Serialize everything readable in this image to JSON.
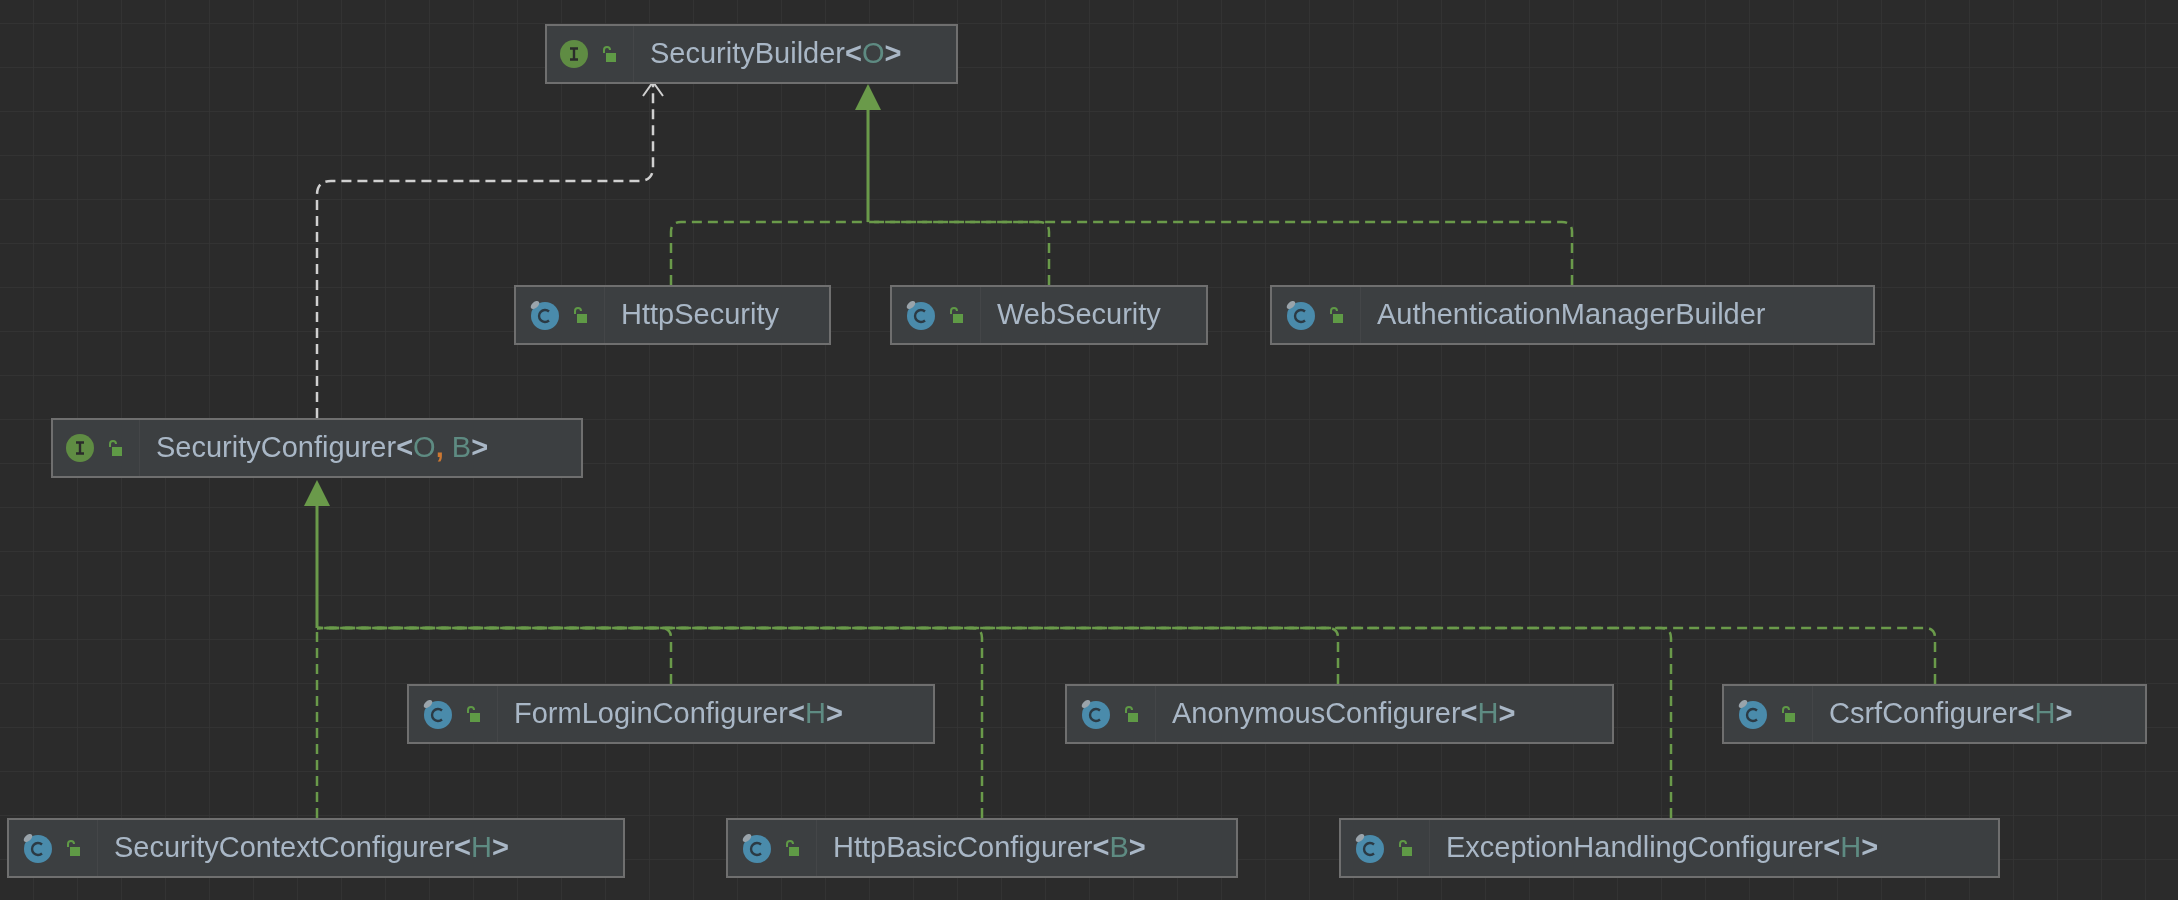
{
  "diagram": {
    "nodes": [
      {
        "kind": "interface",
        "label": [
          {
            "kind": "name",
            "text": "SecurityBuilder"
          },
          {
            "kind": "bracket",
            "text": "<"
          },
          {
            "kind": "param",
            "text": "O"
          },
          {
            "kind": "bracket",
            "text": ">"
          }
        ]
      },
      {
        "kind": "class",
        "label": [
          {
            "kind": "name",
            "text": "HttpSecurity"
          }
        ]
      },
      {
        "kind": "class",
        "label": [
          {
            "kind": "name",
            "text": "WebSecurity"
          }
        ]
      },
      {
        "kind": "class",
        "label": [
          {
            "kind": "name",
            "text": "AuthenticationManagerBuilder"
          }
        ]
      },
      {
        "kind": "interface",
        "label": [
          {
            "kind": "name",
            "text": "SecurityConfigurer"
          },
          {
            "kind": "bracket",
            "text": "<"
          },
          {
            "kind": "param",
            "text": "O"
          },
          {
            "kind": "separator",
            "text": ","
          },
          {
            "kind": "param",
            "text": " B"
          },
          {
            "kind": "bracket",
            "text": ">"
          }
        ]
      },
      {
        "kind": "class",
        "label": [
          {
            "kind": "name",
            "text": "FormLoginConfigurer"
          },
          {
            "kind": "bracket",
            "text": "<"
          },
          {
            "kind": "param",
            "text": "H"
          },
          {
            "kind": "bracket",
            "text": ">"
          }
        ]
      },
      {
        "kind": "class",
        "label": [
          {
            "kind": "name",
            "text": "AnonymousConfigurer"
          },
          {
            "kind": "bracket",
            "text": "<"
          },
          {
            "kind": "param",
            "text": "H"
          },
          {
            "kind": "bracket",
            "text": ">"
          }
        ]
      },
      {
        "kind": "class",
        "label": [
          {
            "kind": "name",
            "text": "CsrfConfigurer"
          },
          {
            "kind": "bracket",
            "text": "<"
          },
          {
            "kind": "param",
            "text": "H"
          },
          {
            "kind": "bracket",
            "text": ">"
          }
        ]
      },
      {
        "kind": "class",
        "label": [
          {
            "kind": "name",
            "text": "SecurityContextConfigurer"
          },
          {
            "kind": "bracket",
            "text": "<"
          },
          {
            "kind": "param",
            "text": "H"
          },
          {
            "kind": "bracket",
            "text": ">"
          }
        ]
      },
      {
        "kind": "class",
        "label": [
          {
            "kind": "name",
            "text": "HttpBasicConfigurer"
          },
          {
            "kind": "bracket",
            "text": "<"
          },
          {
            "kind": "param",
            "text": "B"
          },
          {
            "kind": "bracket",
            "text": ">"
          }
        ]
      },
      {
        "kind": "class",
        "label": [
          {
            "kind": "name",
            "text": "ExceptionHandlingConfigurer"
          },
          {
            "kind": "bracket",
            "text": "<"
          },
          {
            "kind": "param",
            "text": "H"
          },
          {
            "kind": "bracket",
            "text": ">"
          }
        ]
      }
    ]
  }
}
